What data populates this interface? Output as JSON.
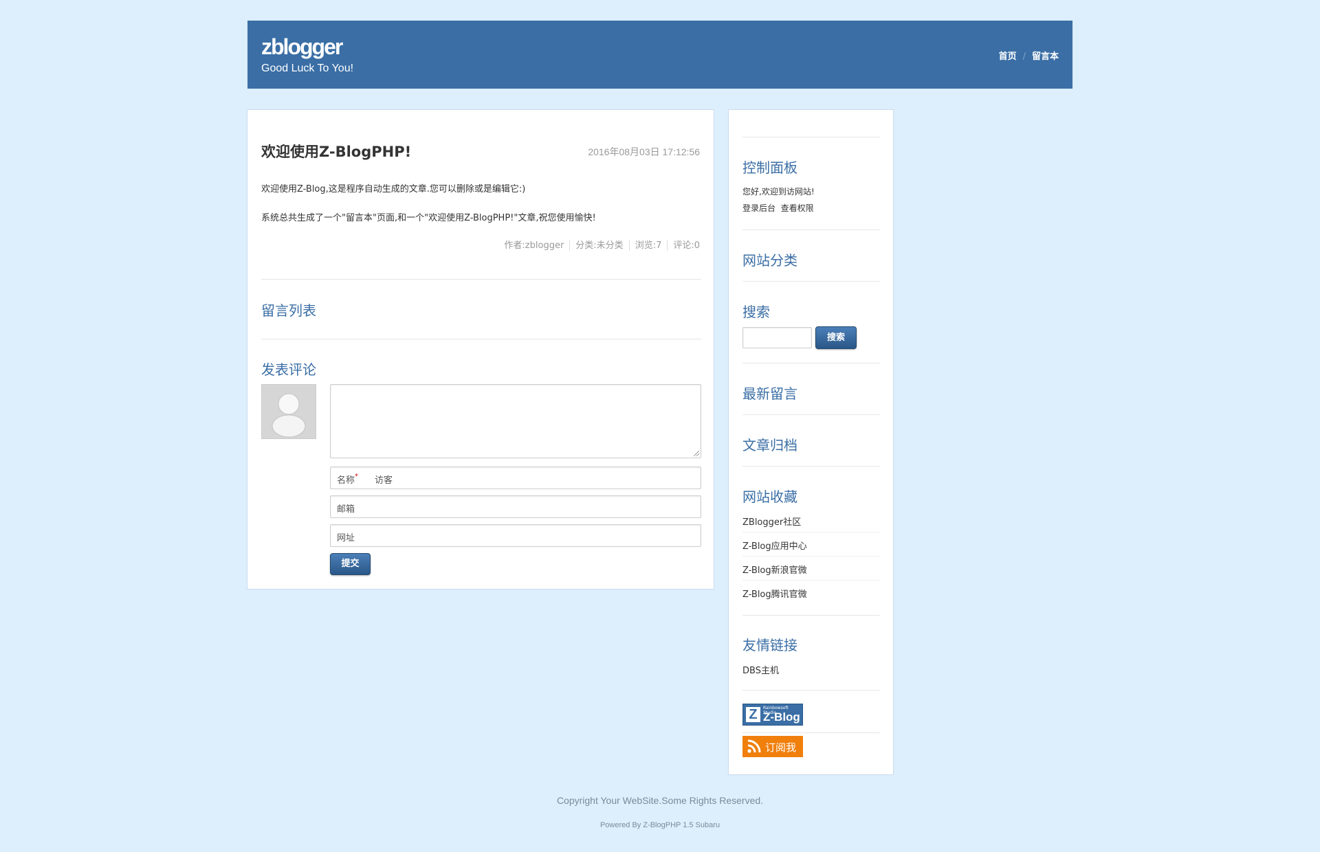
{
  "header": {
    "site_title": "zblogger",
    "subtitle": "Good Luck To You!",
    "nav": [
      {
        "label": "首页"
      },
      {
        "label": "留言本"
      }
    ],
    "nav_separator": "/",
    "bg_color": "#3a6ea5"
  },
  "post": {
    "title": "欢迎使用Z-BlogPHP!",
    "date": "2016年08月03日 17:12:56",
    "paragraphs": [
      "欢迎使用Z-Blog,这是程序自动生成的文章.您可以删除或是编辑它:)",
      "系统总共生成了一个\"留言本\"页面,和一个\"欢迎使用Z-BlogPHP!\"文章,祝您使用愉快!"
    ],
    "meta": {
      "author": "作者:zblogger",
      "category": "分类:未分类",
      "views": "浏览:7",
      "comments": "评论:0"
    }
  },
  "comments": {
    "list_title": "留言列表",
    "form_title": "发表评论",
    "textarea_value": "",
    "name_label": "名称",
    "required_mark": "*",
    "name_value": "访客",
    "email_label": "邮箱",
    "url_label": "网址",
    "submit_label": "提交"
  },
  "sidebar": {
    "control_panel": {
      "title": "控制面板",
      "welcome": "您好,欢迎到访网站!",
      "login": "登录后台",
      "permissions": "查看权限"
    },
    "categories_title": "网站分类",
    "search": {
      "title": "搜索",
      "input_value": "",
      "button_label": "搜索"
    },
    "recent_comments_title": "最新留言",
    "archives_title": "文章归档",
    "favorites": {
      "title": "网站收藏",
      "links": [
        "ZBlogger社区",
        "Z-Blog应用中心",
        "Z-Blog新浪官微",
        "Z-Blog腾讯官微"
      ]
    },
    "friend_links": {
      "title": "友情链接",
      "links": [
        "DBS主机"
      ]
    },
    "zblog_badge": {
      "letter": "Z",
      "small": "Rainbowsoft Studio",
      "big": "Z-Blog"
    },
    "rss_label": "订阅我",
    "rss_color": "#f07f0c"
  },
  "footer": {
    "copyright": "Copyright Your WebSite.Some Rights Reserved.",
    "powered": "Powered By Z-BlogPHP 1.5 Subaru"
  },
  "colors": {
    "page_bg": "#ddeefc",
    "accent": "#3a6ea5"
  },
  "icons": {
    "avatar": "default-user-avatar",
    "rss": "rss-feed-icon"
  }
}
